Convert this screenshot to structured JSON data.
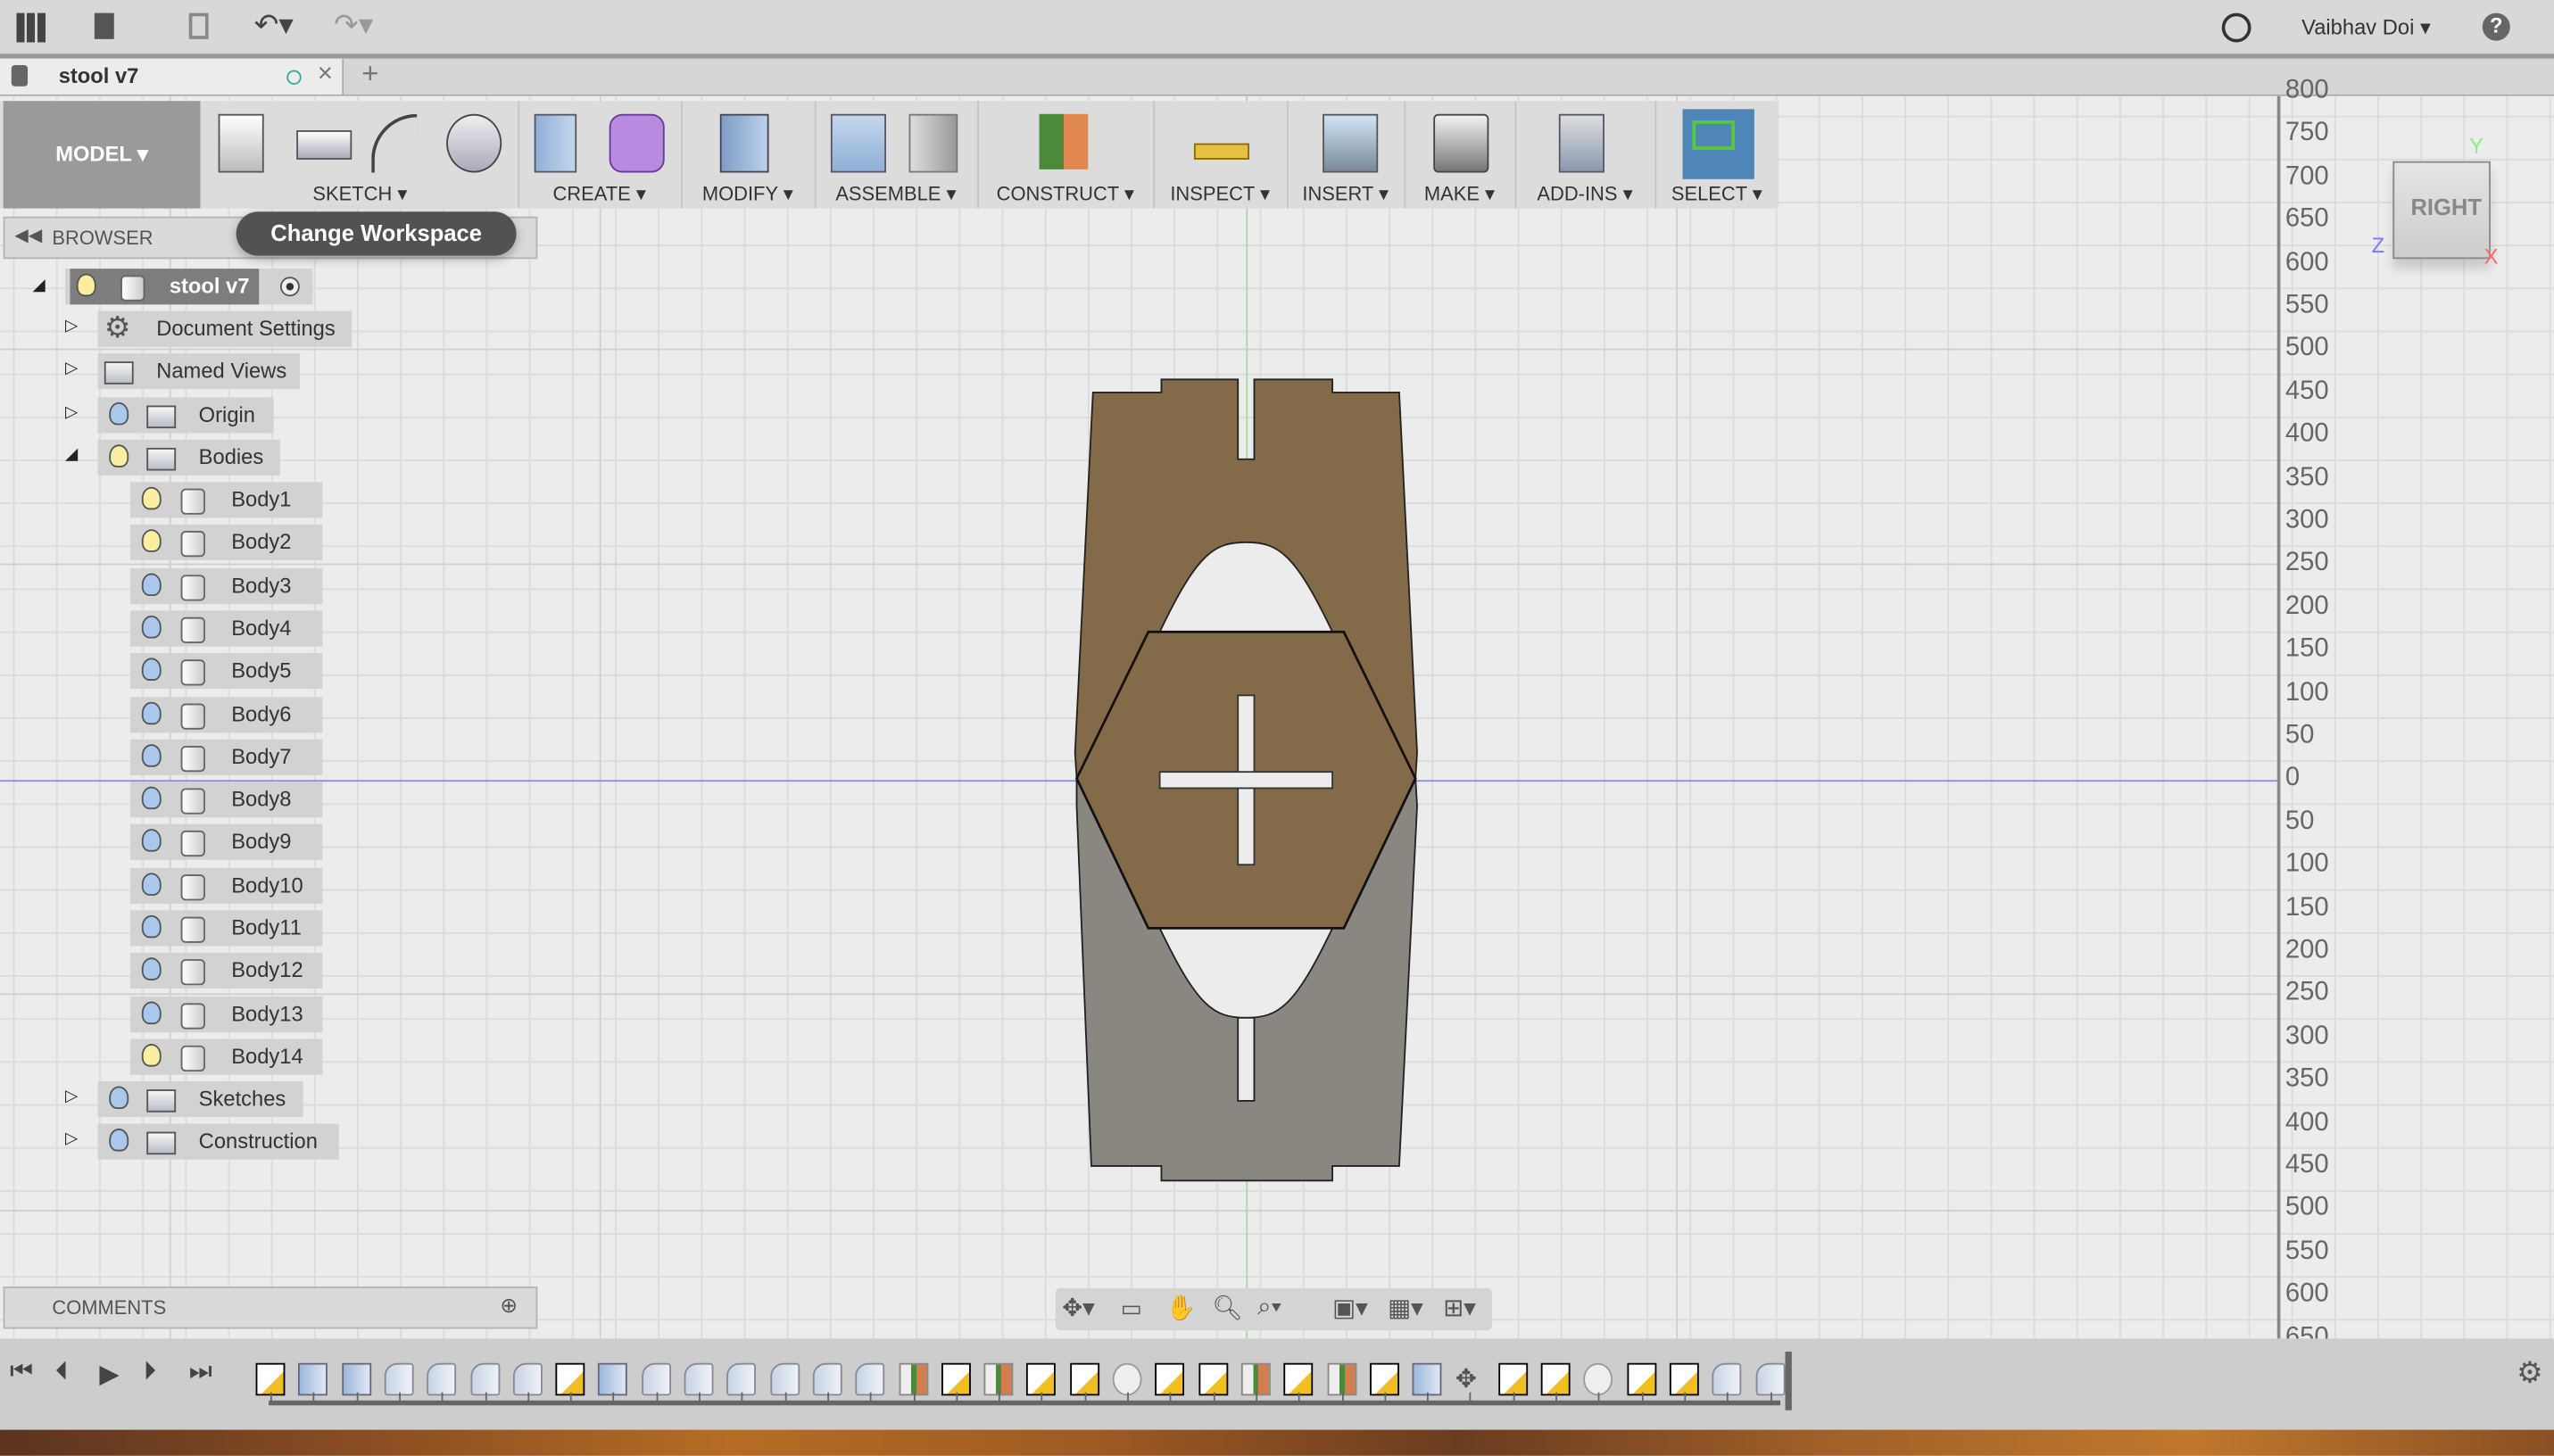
{
  "topbar": {
    "user": "Vaibhav Doi",
    "icons": [
      "grid-apps-icon",
      "file-icon",
      "save-icon",
      "undo-icon",
      "redo-icon",
      "clock-icon",
      "help-icon"
    ]
  },
  "tab": {
    "title": "stool v7",
    "new_tab": "+",
    "close": "×"
  },
  "toolbar": {
    "workspace": "MODEL ▾",
    "groups": [
      {
        "label": "SKETCH ▾"
      },
      {
        "label": "CREATE ▾"
      },
      {
        "label": "MODIFY ▾"
      },
      {
        "label": "ASSEMBLE ▾"
      },
      {
        "label": "CONSTRUCT ▾"
      },
      {
        "label": "INSPECT ▾"
      },
      {
        "label": "INSERT ▾"
      },
      {
        "label": "MAKE ▾"
      },
      {
        "label": "ADD-INS ▾"
      },
      {
        "label": "SELECT ▾"
      }
    ],
    "tooltip": "Change Workspace"
  },
  "browser": {
    "title": "BROWSER",
    "root": "stool v7",
    "items": [
      {
        "label": "Document Settings",
        "icon": "gear"
      },
      {
        "label": "Named Views",
        "icon": "folder"
      },
      {
        "label": "Origin",
        "icon": "folder",
        "bulb": "blue"
      },
      {
        "label": "Bodies",
        "icon": "folder",
        "bulb": "yellow",
        "expanded": true
      }
    ],
    "bodies": [
      {
        "label": "Body1",
        "bulb": "yellow"
      },
      {
        "label": "Body2",
        "bulb": "yellow"
      },
      {
        "label": "Body3",
        "bulb": "blue"
      },
      {
        "label": "Body4",
        "bulb": "blue"
      },
      {
        "label": "Body5",
        "bulb": "blue"
      },
      {
        "label": "Body6",
        "bulb": "blue"
      },
      {
        "label": "Body7",
        "bulb": "blue"
      },
      {
        "label": "Body8",
        "bulb": "blue"
      },
      {
        "label": "Body9",
        "bulb": "blue"
      },
      {
        "label": "Body10",
        "bulb": "blue"
      },
      {
        "label": "Body11",
        "bulb": "blue"
      },
      {
        "label": "Body12",
        "bulb": "blue"
      },
      {
        "label": "Body13",
        "bulb": "blue"
      },
      {
        "label": "Body14",
        "bulb": "yellow"
      }
    ],
    "after": [
      {
        "label": "Sketches",
        "bulb": "blue"
      },
      {
        "label": "Construction",
        "bulb": "blue"
      }
    ]
  },
  "comments": {
    "title": "COMMENTS"
  },
  "ruler": {
    "labels": [
      "800",
      "750",
      "700",
      "650",
      "600",
      "550",
      "500",
      "450",
      "400",
      "350",
      "300",
      "250",
      "200",
      "150",
      "100",
      "50",
      "0",
      "50",
      "100",
      "150",
      "200",
      "250",
      "300",
      "350",
      "400",
      "450",
      "500",
      "550",
      "600",
      "650"
    ]
  },
  "viewcube": {
    "face": "RIGHT",
    "x": "X",
    "y": "Y",
    "z": "Z"
  },
  "colors": {
    "body_brown": "#836a48",
    "body_gray": "#8a8680",
    "selected": "#4f86b8"
  },
  "timeline": {
    "features": [
      "sketch",
      "extrude",
      "extrude",
      "fillet",
      "fillet",
      "fillet",
      "fillet",
      "sketch",
      "extrude",
      "fillet",
      "fillet",
      "fillet",
      "fillet",
      "fillet",
      "fillet",
      "plane",
      "sketch",
      "plane",
      "sketch",
      "sketch",
      "joint",
      "sketch",
      "sketch",
      "plane",
      "sketch",
      "plane",
      "sketch",
      "extrude",
      "move",
      "sketch",
      "sketch",
      "joint",
      "sketch",
      "sketch",
      "fillet",
      "fillet"
    ]
  }
}
